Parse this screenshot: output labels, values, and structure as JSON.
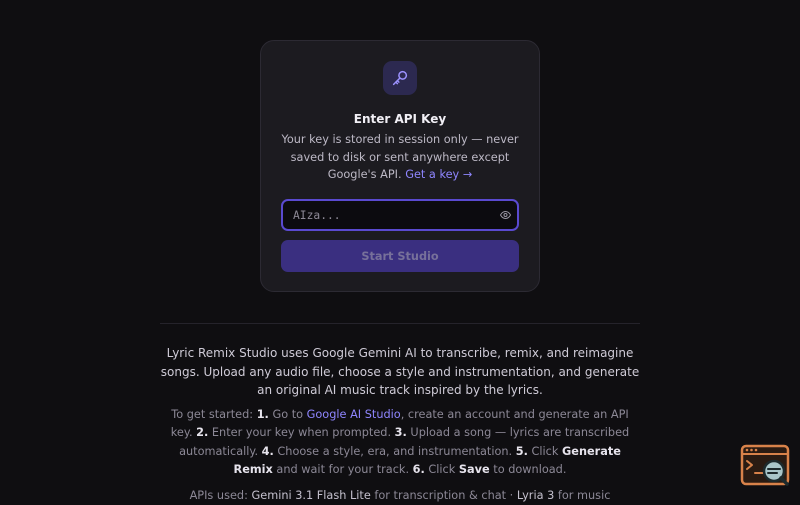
{
  "api_card": {
    "title": "Enter API Key",
    "description": "Your key is stored in session only — never saved to disk or sent anywhere except Google's API.",
    "get_key_link": "Get a key →",
    "input_placeholder": "AIza...",
    "input_value": "",
    "start_button_label": "Start Studio",
    "icon": "key-icon",
    "accent_color": "#5a4ad0"
  },
  "intro": {
    "text": "Lyric Remix Studio uses Google Gemini AI to transcribe, remix, and reimagine songs. Upload any audio file, choose a style and instrumentation, and generate an original AI music track inspired by the lyrics."
  },
  "steps": {
    "lead": "To get started:",
    "s1_num": "1.",
    "s1_pre": "Go to",
    "s1_link": "Google AI Studio",
    "s1_post": ", create an account and generate an API key.",
    "s2_num": "2.",
    "s2_text": "Enter your key when prompted.",
    "s3_num": "3.",
    "s3_text": "Upload a song — lyrics are transcribed automatically.",
    "s4_num": "4.",
    "s4_text": "Choose a style, era, and instrumentation.",
    "s5_num": "5.",
    "s5_pre": "Click",
    "s5_action": "Generate Remix",
    "s5_post": "and wait for your track.",
    "s6_num": "6.",
    "s6_pre": "Click",
    "s6_action": "Save",
    "s6_post": "to download."
  },
  "apis": {
    "lead": "APIs used:",
    "model1": "Gemini 3.1 Flash Lite",
    "model1_use": "for transcription & chat ·",
    "model2": "Lyria 3",
    "model2_use": "for music"
  },
  "assistant_widget": {
    "icon": "code-search-icon"
  }
}
